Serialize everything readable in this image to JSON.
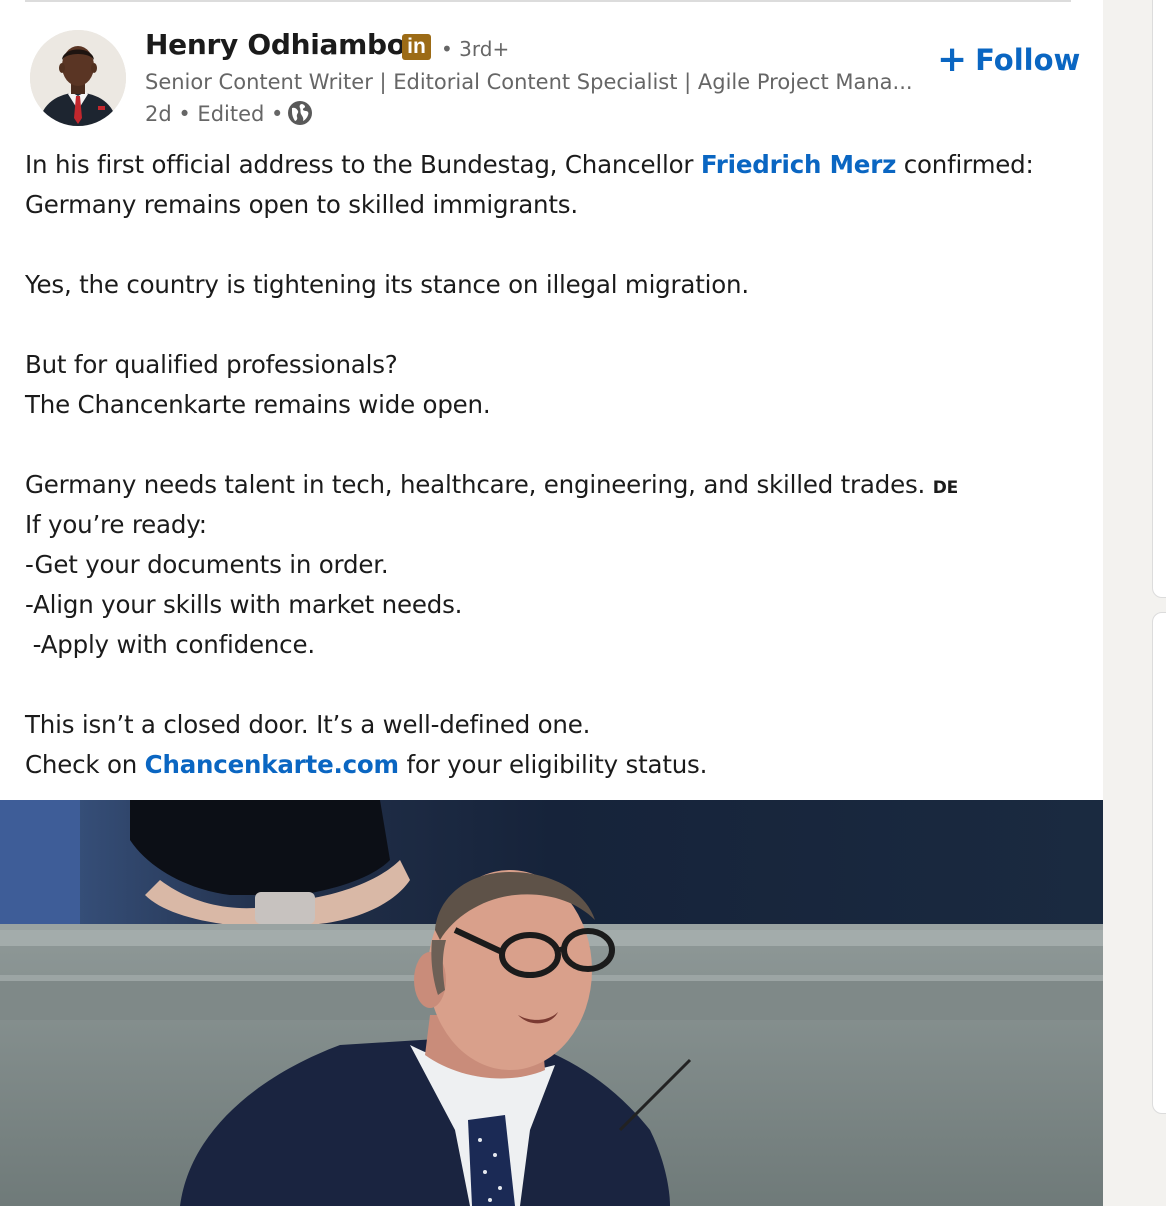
{
  "author": {
    "name": "Henry Odhiambo",
    "badge_label": "in",
    "degree": "• 3rd+",
    "headline": "Senior Content Writer | Editorial Content Specialist | Agile Project Mana...",
    "meta": "2d • Edited •",
    "globe_icon": "globe-icon"
  },
  "follow": {
    "icon": "+",
    "label": "Follow"
  },
  "post": {
    "p1_a": "In his first official address to the Bundestag, Chancellor ",
    "p1_link": "Friedrich Merz",
    "p1_b": " confirmed:",
    "p1_line2": "Germany remains open to skilled immigrants.",
    "p2": "Yes, the country is tightening its stance on illegal migration.",
    "p3_line1": "But for qualified professionals?",
    "p3_line2": "The Chancenkarte remains wide open.",
    "p4_line1": "Germany needs talent in tech, healthcare, engineering, and skilled trades.",
    "p4_flag": "DE",
    "p4_line2": "If you’re ready:",
    "p4_line3": "-Get your documents in order.",
    "p4_line4": "-Align your skills with market needs.",
    "p4_line5": " -Apply with confidence.",
    "p5_line1": "This isn’t a closed door. It’s a well-defined one.",
    "p5_a": "Check on ",
    "p5_link": "Chancenkarte.com",
    "p5_b": " for your eligibility status."
  },
  "colors": {
    "link": "#0a66c2",
    "linkedin_badge": "#9c6b16",
    "muted_text": "#666666"
  }
}
